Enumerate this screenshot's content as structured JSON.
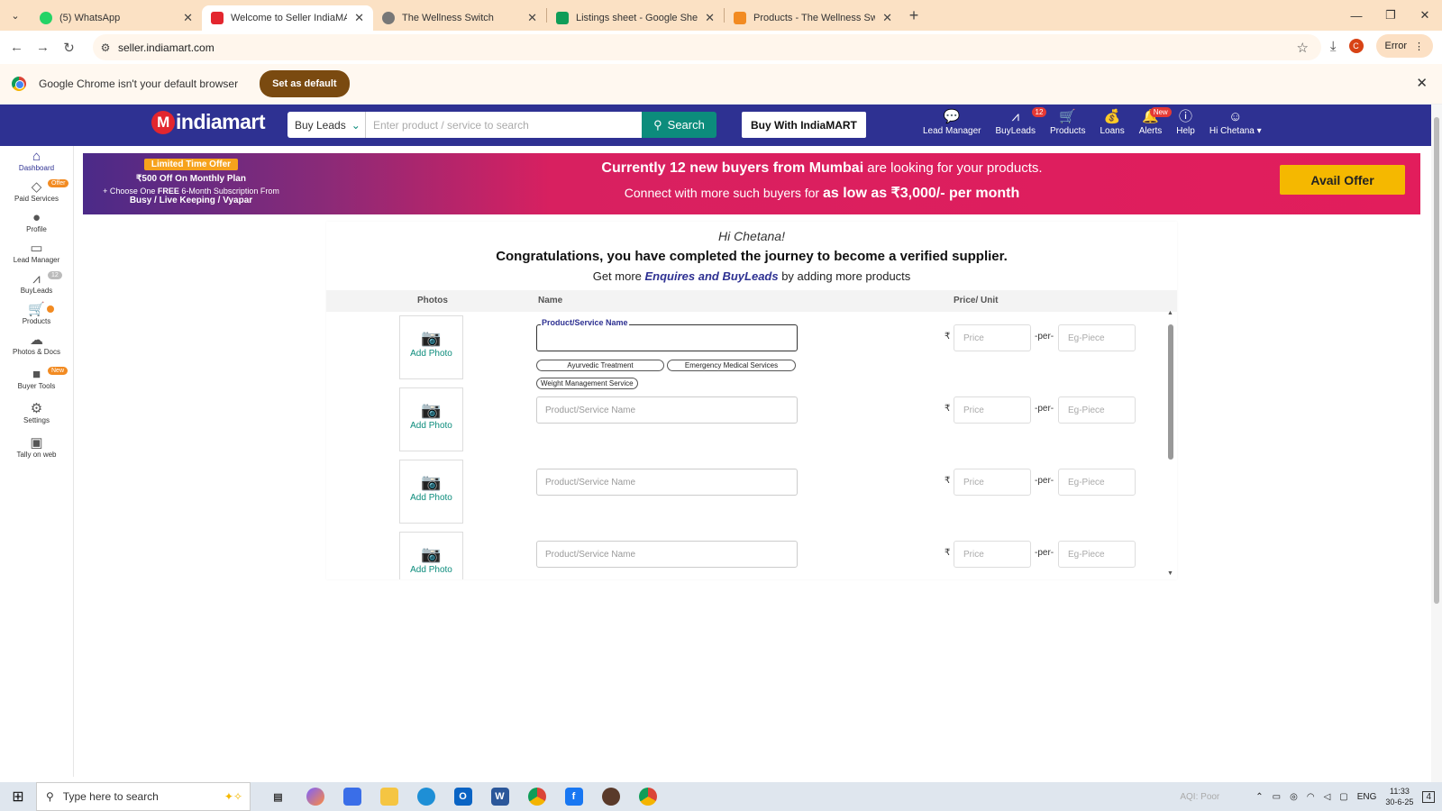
{
  "browser": {
    "tabs": [
      {
        "title": "(5) WhatsApp",
        "color": "#25d366",
        "active": false
      },
      {
        "title": "Welcome to Seller IndiaMART",
        "color": "#e3262f",
        "active": true
      },
      {
        "title": "The Wellness Switch",
        "color": "#666666",
        "active": false
      },
      {
        "title": "Listings sheet - Google Sheets",
        "color": "#0f9d58",
        "active": false
      },
      {
        "title": "Products - The Wellness Switch",
        "color": "#f28b22",
        "active": false
      }
    ],
    "url": "seller.indiamart.com",
    "error_label": "Error",
    "profile_initial": "C"
  },
  "infobar": {
    "message": "Google Chrome isn't your default browser",
    "button": "Set as default"
  },
  "header": {
    "logo_text": "indiamart",
    "search_type": "Buy Leads",
    "search_placeholder": "Enter product / service to search",
    "search_button": "Search",
    "buy_with": "Buy With IndiaMART",
    "nav": {
      "lead_manager": "Lead Manager",
      "buyleads": "BuyLeads",
      "buyleads_badge": "12",
      "products": "Products",
      "loans": "Loans",
      "alerts": "Alerts",
      "alerts_badge": "New",
      "help": "Help",
      "user": "Hi Chetana"
    }
  },
  "sidebar": {
    "dashboard": "Dashboard",
    "paid_services": "Paid Services",
    "paid_badge": "Offer",
    "profile": "Profile",
    "lead_manager": "Lead Manager",
    "buyleads": "BuyLeads",
    "buyleads_badge": "12",
    "products": "Products",
    "photos_docs": "Photos & Docs",
    "buyer_tools": "Buyer Tools",
    "buyer_badge": "New",
    "settings": "Settings",
    "tally": "Tally on web"
  },
  "banner": {
    "offer_tag": "Limited Time Offer",
    "line1": "₹500 Off On Monthly Plan",
    "line2_pre": "+ Choose One ",
    "line2_bold": "FREE",
    "line2_post": " 6-Month Subscription From",
    "line3": "Busy / Live Keeping / Vyapar",
    "main1_bold": "Currently 12 new buyers from Mumbai",
    "main1_rest": " are looking for your products.",
    "main2_pre": "Connect with more such buyers for ",
    "main2_bold": "as low as ₹3,000/- per month",
    "cta": "Avail Offer"
  },
  "panel": {
    "greeting": "Hi Chetana!",
    "congrats": "Congratulations, you have completed the journey to become a verified supplier.",
    "getmore_pre": "Get more ",
    "getmore_em": "Enquires and BuyLeads",
    "getmore_post": " by adding more products",
    "col_photos": "Photos",
    "col_name": "Name",
    "col_price": "Price/ Unit",
    "add_photo": "Add Photo",
    "field_label": "Product/Service Name",
    "name_placeholder": "Product/Service Name",
    "price_placeholder": "Price",
    "per": "-per-",
    "unit_placeholder": "Eg-Piece",
    "rupee": "₹",
    "suggestions": [
      "Ayurvedic Treatment",
      "Emergency Medical Services",
      "Weight Management Service"
    ]
  },
  "taskbar": {
    "search": "Type here to search",
    "aqi": "AQI: Poor",
    "lang": "ENG",
    "time": "11:33",
    "date": "30-6-25",
    "notif": "4"
  }
}
